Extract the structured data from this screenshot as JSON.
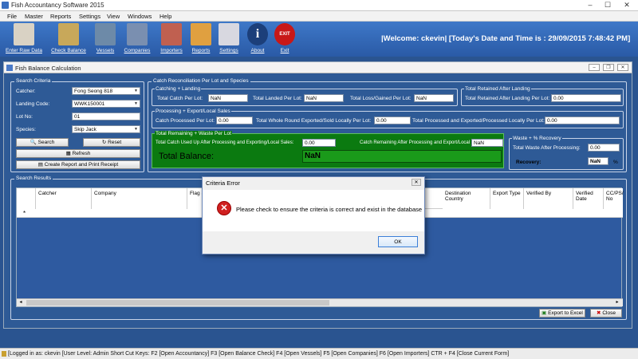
{
  "app": {
    "title": "Fish Accountancy Software 2015"
  },
  "menu": [
    "File",
    "Master",
    "Reports",
    "Settings",
    "View",
    "Windows",
    "Help"
  ],
  "toolbar": [
    {
      "label": "Enter Raw Data",
      "icon": "calculator-icon",
      "color": "#d9d2c4"
    },
    {
      "label": "Check Balance",
      "icon": "balance-scale-icon",
      "color": "#c8a85a"
    },
    {
      "label": "Vessels",
      "icon": "vessel-icon",
      "color": "#6d8aa8"
    },
    {
      "label": "Companies",
      "icon": "company-icon",
      "color": "#7a8fb0"
    },
    {
      "label": "Importers",
      "icon": "importers-icon",
      "color": "#c06050"
    },
    {
      "label": "Reports",
      "icon": "reports-icon",
      "color": "#e0a040"
    },
    {
      "label": "Settings",
      "icon": "settings-icon",
      "color": "#d8d8e0"
    },
    {
      "label": "About",
      "icon": "info-icon",
      "color": "#1c3f7a"
    },
    {
      "label": "Exit",
      "icon": "exit-icon",
      "color": "#c81818"
    }
  ],
  "welcome": "|Welcome:  ckevin|  [Today's Date and Time is : 29/09/2015 7:48:42 PM]",
  "window": {
    "title": "Fish Balance Calculation"
  },
  "criteria": {
    "title": "Search Criteria",
    "catcher_label": "Catcher:",
    "catcher_value": "Fong Seong 818",
    "landing_label": "Landing Code:",
    "landing_value": "WWK150001",
    "lot_label": "Lot No:",
    "lot_value": "01",
    "species_label": "Species:",
    "species_value": "Skip Jack",
    "search": "Search",
    "reset": "Reset",
    "refresh": "Refresh",
    "report": "Create Report and Print Receipt"
  },
  "recon": {
    "title": "Catch Reconciliation Per Lot and Species",
    "landing": {
      "title": "Catching + Landing",
      "catch_label": "Total Catch Per Lot:",
      "catch": "NaN",
      "landed_label": "Total Landed Per Lot:",
      "landed": "NaN",
      "loss_label": "Total Loss/Gained Per Lot:",
      "loss": "NaN"
    },
    "retained": {
      "title": "Total Retained After Landing",
      "label": "Total Retained After Landing Per Lot:",
      "value": "0.00"
    },
    "processing": {
      "title": "Processing + Export/Local Sales",
      "processed_label": "Catch Processed Per Lot:",
      "processed": "0.00",
      "whole_label": "Total Whole Round Exported/Sold Locally  Per Lot:",
      "whole": "0.00",
      "total_label": "Total Processed and Exported/Processed Locally Per Lot:",
      "total": "0.00"
    },
    "remaining": {
      "title": "Total Remaining + Waste Per Lot",
      "used_label": "Total Catch Used Up After Processing and Exporting/Local Sales:",
      "used": "0.00",
      "rem_label": "Catch Remaining After Processing and Export/Local Sales:",
      "rem": "NaN",
      "balance_label": "Total Balance:",
      "balance": "NaN"
    },
    "waste": {
      "title": "Waste + % Recovery",
      "waste_label": "Total Waste After Processing:",
      "waste": "0.00",
      "recovery_label": "Recovery:",
      "recovery": "NaN",
      "pct": "%"
    }
  },
  "results": {
    "title": "Search Results",
    "columns": [
      "Catcher",
      "Company",
      "Flag St",
      "Destination Country",
      "Export Type",
      "Verified By",
      "Verified Date",
      "CC/PS/ No"
    ],
    "new_row": "*",
    "export": "Export to Excel",
    "close": "Close"
  },
  "dialog": {
    "title": "Criteria Error",
    "message": "Please check to ensure the criteria is correct and exist in the database",
    "ok": "OK"
  },
  "status": "[Logged in as:  ckevin  [User Level:  Admin  Short Cut Keys:  F2 [Open Accountancy]  F3 [Open Balance Check]  F4 [Open Vessels]  F5 [Open Companies]  F6 [Open Importers]  CTR + F4 [Close Current Form]"
}
